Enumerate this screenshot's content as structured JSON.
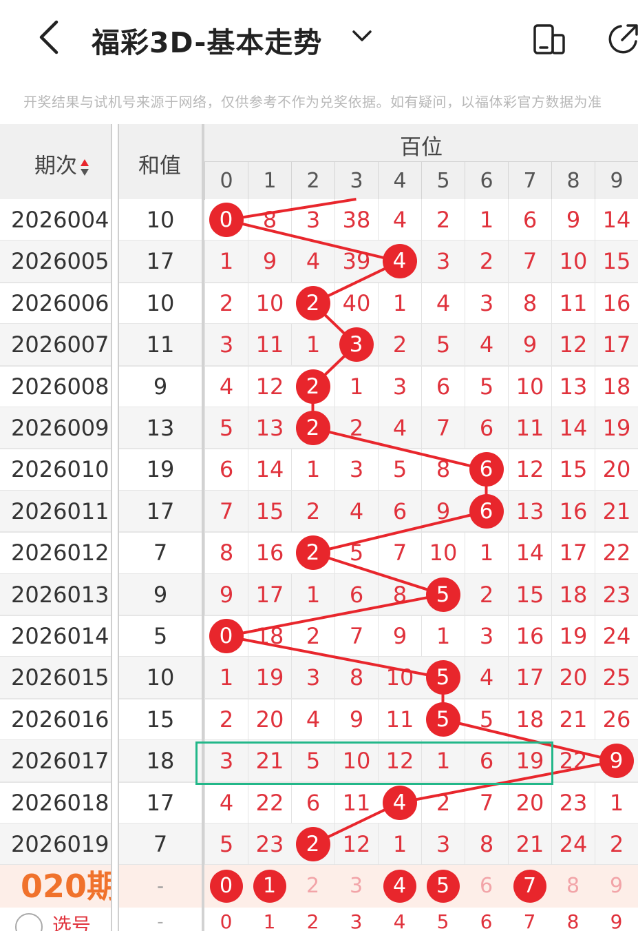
{
  "header": {
    "title": "福彩3D-基本走势",
    "back_icon": "chevron-left-icon",
    "menu_icon": "chevron-down-icon",
    "device_icon": "device-icon",
    "share_icon": "share-icon"
  },
  "notice": "开奖结果与试机号来源于网络，仅供参考不作为兑奖依据。如有疑问，以福体彩官方数据为准",
  "table": {
    "col_issue": "期次",
    "col_sum": "和值",
    "group_title": "百位",
    "digits": [
      "0",
      "1",
      "2",
      "3",
      "4",
      "5",
      "6",
      "7",
      "8",
      "9"
    ],
    "rows": [
      {
        "issue": "2026004",
        "sum": "10",
        "hit": 0,
        "cells": [
          "0",
          "8",
          "3",
          "38",
          "4",
          "2",
          "1",
          "6",
          "9",
          "14"
        ]
      },
      {
        "issue": "2026005",
        "sum": "17",
        "hit": 4,
        "cells": [
          "1",
          "9",
          "4",
          "39",
          "4",
          "3",
          "2",
          "7",
          "10",
          "15"
        ]
      },
      {
        "issue": "2026006",
        "sum": "10",
        "hit": 2,
        "cells": [
          "2",
          "10",
          "2",
          "40",
          "1",
          "4",
          "3",
          "8",
          "11",
          "16"
        ]
      },
      {
        "issue": "2026007",
        "sum": "11",
        "hit": 3,
        "cells": [
          "3",
          "11",
          "1",
          "3",
          "2",
          "5",
          "4",
          "9",
          "12",
          "17"
        ]
      },
      {
        "issue": "2026008",
        "sum": "9",
        "hit": 2,
        "cells": [
          "4",
          "12",
          "2",
          "1",
          "3",
          "6",
          "5",
          "10",
          "13",
          "18"
        ]
      },
      {
        "issue": "2026009",
        "sum": "13",
        "hit": 2,
        "cells": [
          "5",
          "13",
          "2",
          "2",
          "4",
          "7",
          "6",
          "11",
          "14",
          "19"
        ]
      },
      {
        "issue": "2026010",
        "sum": "19",
        "hit": 6,
        "cells": [
          "6",
          "14",
          "1",
          "3",
          "5",
          "8",
          "6",
          "12",
          "15",
          "20"
        ]
      },
      {
        "issue": "2026011",
        "sum": "17",
        "hit": 6,
        "cells": [
          "7",
          "15",
          "2",
          "4",
          "6",
          "9",
          "6",
          "13",
          "16",
          "21"
        ]
      },
      {
        "issue": "2026012",
        "sum": "7",
        "hit": 2,
        "cells": [
          "8",
          "16",
          "2",
          "5",
          "7",
          "10",
          "1",
          "14",
          "17",
          "22"
        ]
      },
      {
        "issue": "2026013",
        "sum": "9",
        "hit": 5,
        "cells": [
          "9",
          "17",
          "1",
          "6",
          "8",
          "5",
          "2",
          "15",
          "18",
          "23"
        ]
      },
      {
        "issue": "2026014",
        "sum": "5",
        "hit": 0,
        "cells": [
          "0",
          "18",
          "2",
          "7",
          "9",
          "1",
          "3",
          "16",
          "19",
          "24"
        ]
      },
      {
        "issue": "2026015",
        "sum": "10",
        "hit": 5,
        "cells": [
          "1",
          "19",
          "3",
          "8",
          "10",
          "5",
          "4",
          "17",
          "20",
          "25"
        ]
      },
      {
        "issue": "2026016",
        "sum": "15",
        "hit": 5,
        "cells": [
          "2",
          "20",
          "4",
          "9",
          "11",
          "5",
          "5",
          "18",
          "21",
          "26"
        ]
      },
      {
        "issue": "2026017",
        "sum": "18",
        "hit": 9,
        "cells": [
          "3",
          "21",
          "5",
          "10",
          "12",
          "1",
          "6",
          "19",
          "22",
          "9"
        ]
      },
      {
        "issue": "2026018",
        "sum": "17",
        "hit": 4,
        "cells": [
          "4",
          "22",
          "6",
          "11",
          "4",
          "2",
          "7",
          "20",
          "23",
          "1"
        ]
      },
      {
        "issue": "2026019",
        "sum": "7",
        "hit": 2,
        "cells": [
          "5",
          "23",
          "2",
          "12",
          "1",
          "3",
          "8",
          "21",
          "24",
          "2"
        ]
      }
    ],
    "pick_row": {
      "label": "020期",
      "sum": "-",
      "cells": [
        "0",
        "1",
        "2",
        "3",
        "4",
        "5",
        "6",
        "7",
        "8",
        "9"
      ],
      "picked": [
        true,
        true,
        false,
        false,
        true,
        true,
        false,
        true,
        false,
        false
      ]
    },
    "select_row": {
      "label": "选号",
      "sum": "-",
      "cells": [
        "0",
        "1",
        "2",
        "3",
        "4",
        "5",
        "6",
        "7",
        "8",
        "9"
      ]
    }
  },
  "colors": {
    "accent": "#e8262c",
    "highlight_border": "#22b789",
    "pick_label": "#f0722c"
  }
}
